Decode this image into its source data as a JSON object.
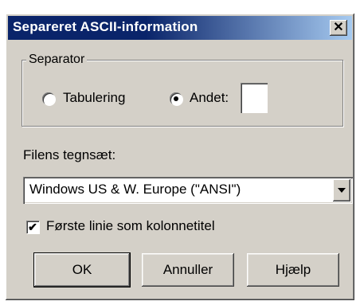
{
  "window": {
    "title": "Separeret ASCII-information",
    "close_glyph": "✕"
  },
  "separator": {
    "group_label": "Separator",
    "options": [
      {
        "label": "Tabulering",
        "selected": false
      },
      {
        "label": "Andet:",
        "selected": true
      }
    ],
    "other_value": ""
  },
  "charset": {
    "label": "Filens tegnsæt:",
    "selected": "Windows US & W. Europe (\"ANSI\")"
  },
  "first_row_header": {
    "label": "Første linie som kolonnetitel",
    "checked": true,
    "check_glyph": "✔"
  },
  "buttons": {
    "ok": "OK",
    "cancel": "Annuller",
    "help": "Hjælp"
  },
  "colors": {
    "title_bar": "#0a246a",
    "face": "#d4d0c8"
  }
}
